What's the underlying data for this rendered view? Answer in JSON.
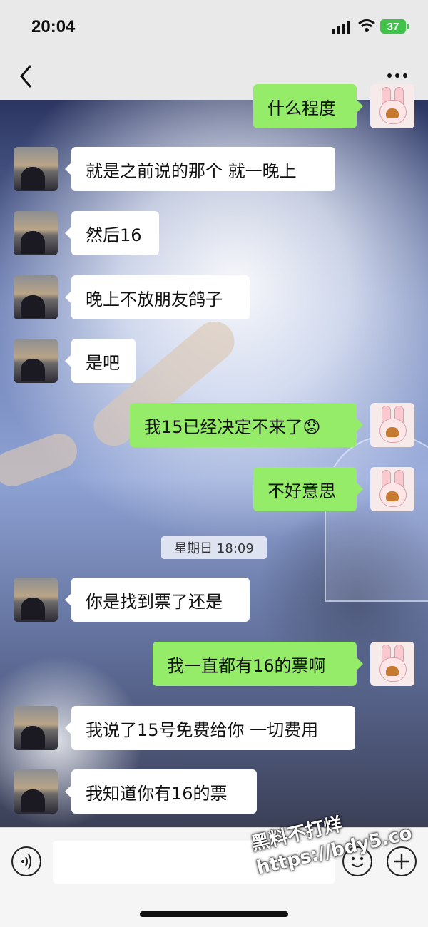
{
  "status_bar": {
    "time": "20:04",
    "battery": "37"
  },
  "nav": {
    "back_icon": "chevron-left-icon",
    "more_icon": "more-dots-icon"
  },
  "messages": [
    {
      "side": "me",
      "text": "什么程度"
    },
    {
      "side": "peer",
      "text": "就是之前说的那个 就一晚上"
    },
    {
      "side": "peer",
      "text": "然后16"
    },
    {
      "side": "peer",
      "text": "晚上不放朋友鸽子"
    },
    {
      "side": "peer",
      "text": "是吧"
    },
    {
      "side": "me",
      "text": "我15已经决定不来了😟"
    },
    {
      "side": "me",
      "text": "不好意思"
    },
    {
      "side": "peer",
      "text": "你是找到票了还是"
    },
    {
      "side": "me",
      "text": "我一直都有16的票啊"
    },
    {
      "side": "peer",
      "text": "我说了15号免费给你 一切费用"
    },
    {
      "side": "peer",
      "text": "我知道你有16的票"
    }
  ],
  "time_divider": "星期日 18:09",
  "input_bar": {
    "voice_icon": "voice-icon",
    "emoji_icon": "emoji-icon",
    "plus_icon": "plus-icon",
    "value": ""
  },
  "watermark": {
    "line1": "黑料不打烊",
    "line2": "https://bdy5.co"
  },
  "colors": {
    "my_bubble": "#95ec69",
    "peer_bubble": "#ffffff",
    "battery": "#41c34b"
  }
}
